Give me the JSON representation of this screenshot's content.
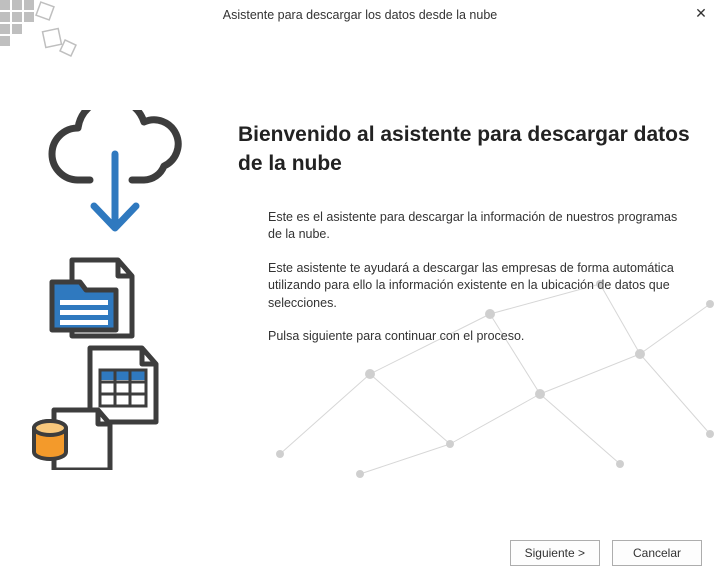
{
  "window": {
    "title": "Asistente para descargar los datos desde la nube",
    "close_label": "✕"
  },
  "main": {
    "heading": "Bienvenido al asistente para descargar datos de la nube",
    "p1": "Este es el asistente para descargar la información de nuestros programas de la nube.",
    "p2": "Este asistente te ayudará a descargar las empresas de forma automática utilizando para ello la información existente en la ubicación de datos que selecciones.",
    "p3": "Pulsa siguiente para continuar con el proceso."
  },
  "buttons": {
    "next": "Siguiente >",
    "cancel": "Cancelar"
  }
}
